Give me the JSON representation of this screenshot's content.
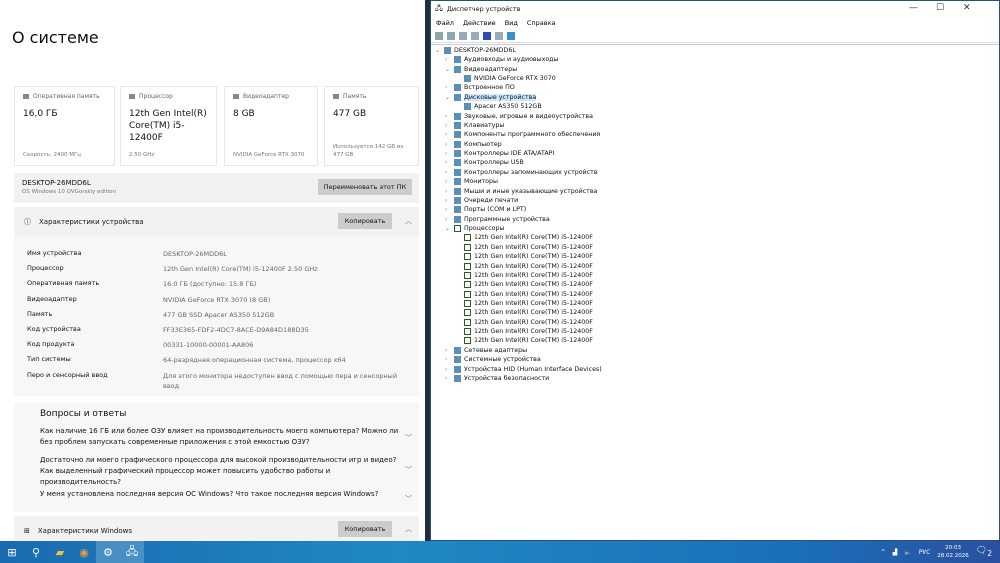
{
  "settings": {
    "title": "О системе",
    "cards": [
      {
        "label": "Оперативная память",
        "value": "16,0 ГБ",
        "sub": "Скорость: 2400 МГц"
      },
      {
        "label": "Процессор",
        "value": "12th Gen Intel(R) Core(TM) i5-12400F",
        "sub": "2.50 GHz"
      },
      {
        "label": "Видеоадаптер",
        "value": "8 GB",
        "sub": "NVIDIA GeForce RTX 3070"
      },
      {
        "label": "Память",
        "value": "477 GB",
        "sub": "Используется 142 GB из 477 GB"
      }
    ],
    "device_name": "DESKTOP-26MDD6L",
    "edition": "OS Windows 10 OVGorskiy edition",
    "rename_button": "Переименовать этот ПК",
    "device_specs_title": "Характеристики устройства",
    "copy_button": "Копировать",
    "specs": [
      {
        "k": "Имя устройства",
        "v": "DESKTOP-26MDD6L"
      },
      {
        "k": "Процессор",
        "v": "12th Gen Intel(R) Core(TM) i5-12400F   2.50 GHz"
      },
      {
        "k": "Оперативная память",
        "v": "16.0 ГБ (доступно: 15.8 ГБ)"
      },
      {
        "k": "Видеоадаптер",
        "v": "NVIDIA GeForce RTX 3070 (8 GB)"
      },
      {
        "k": "Память",
        "v": "477 GB SSD Apacer AS350 512GB"
      },
      {
        "k": "Код устройства",
        "v": "FF33E365-FDF2-4DC7-8ACE-D9A84D188D35"
      },
      {
        "k": "Код продукта",
        "v": "00331-10000-00001-AA806"
      },
      {
        "k": "Тип системы",
        "v": "64-разрядная операционная система, процессор x64"
      },
      {
        "k": "Перо и сенсорный ввод",
        "v": "Для этого монитора недоступен ввод с помощью пера и сенсорный ввод"
      }
    ],
    "qa_title": "Вопросы и ответы",
    "questions": [
      "Как наличие 16 ГБ или более ОЗУ влияет на производительность моего компьютера? Можно ли без проблем запускать современные приложения с этой емкостью ОЗУ?",
      "Достаточно ли моего графического процессора для высокой производительности игр и видео? Как выделенный графический процессор может повысить удобство работы и производительность?",
      "У меня установлена последняя версия ОС Windows? Что такое последняя версия Windows?"
    ],
    "windows_specs_title": "Характеристики Windows",
    "copy_button2": "Копировать"
  },
  "devmgr": {
    "title": "Диспетчер устройств",
    "menu": [
      "Файл",
      "Действие",
      "Вид",
      "Справка"
    ],
    "tree": [
      {
        "t": "DESKTOP-26MDD6L",
        "l": 0,
        "s": "open"
      },
      {
        "t": "Аудиовходы и аудиовыходы",
        "l": 1,
        "s": "closed"
      },
      {
        "t": "Видеоадаптеры",
        "l": 1,
        "s": "open"
      },
      {
        "t": "NVIDIA GeForce RTX 3070",
        "l": 2
      },
      {
        "t": "Встроенное ПО",
        "l": 1,
        "s": "closed"
      },
      {
        "t": "Дисковые устройства",
        "l": 1,
        "s": "open",
        "sel": true
      },
      {
        "t": "Apacer AS350 512GB",
        "l": 2
      },
      {
        "t": "Звуковые, игровые и видеоустройства",
        "l": 1,
        "s": "closed"
      },
      {
        "t": "Клавиатуры",
        "l": 1,
        "s": "closed"
      },
      {
        "t": "Компоненты программного обеспечения",
        "l": 1,
        "s": "closed"
      },
      {
        "t": "Компьютер",
        "l": 1,
        "s": "closed"
      },
      {
        "t": "Контроллеры IDE ATA/ATAPI",
        "l": 1,
        "s": "closed"
      },
      {
        "t": "Контроллеры USB",
        "l": 1,
        "s": "closed"
      },
      {
        "t": "Контроллеры запоминающих устройств",
        "l": 1,
        "s": "closed"
      },
      {
        "t": "Мониторы",
        "l": 1,
        "s": "closed"
      },
      {
        "t": "Мыши и иные указывающие устройства",
        "l": 1,
        "s": "closed"
      },
      {
        "t": "Очереди печати",
        "l": 1,
        "s": "closed"
      },
      {
        "t": "Порты (COM и LPT)",
        "l": 1,
        "s": "closed"
      },
      {
        "t": "Программные устройства",
        "l": 1,
        "s": "closed"
      },
      {
        "t": "Процессоры",
        "l": 1,
        "s": "open",
        "cpu": true
      },
      {
        "t": "12th Gen Intel(R) Core(TM) i5-12400F",
        "l": 2,
        "cpu": true
      },
      {
        "t": "12th Gen Intel(R) Core(TM) i5-12400F",
        "l": 2,
        "cpu": true
      },
      {
        "t": "12th Gen Intel(R) Core(TM) i5-12400F",
        "l": 2,
        "cpu": true
      },
      {
        "t": "12th Gen Intel(R) Core(TM) i5-12400F",
        "l": 2,
        "cpu": true
      },
      {
        "t": "12th Gen Intel(R) Core(TM) i5-12400F",
        "l": 2,
        "cpu": true
      },
      {
        "t": "12th Gen Intel(R) Core(TM) i5-12400F",
        "l": 2,
        "cpu": true
      },
      {
        "t": "12th Gen Intel(R) Core(TM) i5-12400F",
        "l": 2,
        "cpu": true
      },
      {
        "t": "12th Gen Intel(R) Core(TM) i5-12400F",
        "l": 2,
        "cpu": true
      },
      {
        "t": "12th Gen Intel(R) Core(TM) i5-12400F",
        "l": 2,
        "cpu": true
      },
      {
        "t": "12th Gen Intel(R) Core(TM) i5-12400F",
        "l": 2,
        "cpu": true
      },
      {
        "t": "12th Gen Intel(R) Core(TM) i5-12400F",
        "l": 2,
        "cpu": true
      },
      {
        "t": "12th Gen Intel(R) Core(TM) i5-12400F",
        "l": 2,
        "cpu": true
      },
      {
        "t": "Сетевые адаптеры",
        "l": 1,
        "s": "closed"
      },
      {
        "t": "Системные устройства",
        "l": 1,
        "s": "closed"
      },
      {
        "t": "Устройства HID (Human Interface Devices)",
        "l": 1,
        "s": "closed"
      },
      {
        "t": "Устройства безопасности",
        "l": 1,
        "s": "closed"
      }
    ]
  },
  "taskbar": {
    "lang": "РУС",
    "time": "20:03",
    "date": "28.02.2026",
    "notifications": "2"
  }
}
